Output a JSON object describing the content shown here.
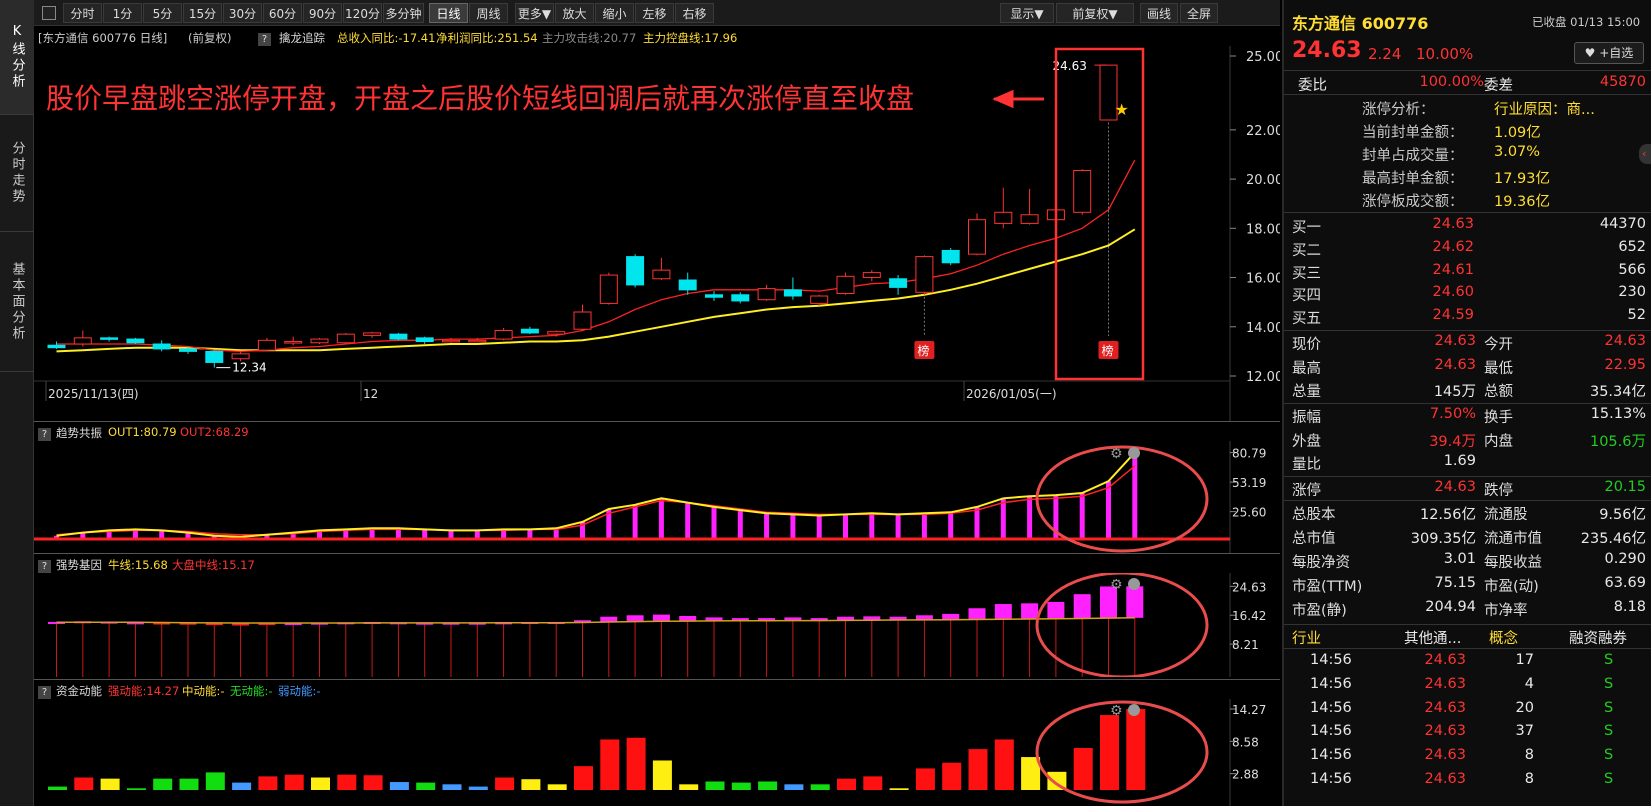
{
  "left_tabs": [
    "K线分析",
    "分时走势",
    "基本面分析"
  ],
  "toolbar": {
    "periods": [
      "分时",
      "1分",
      "5分",
      "15分",
      "30分",
      "60分",
      "90分",
      "120分",
      "多分钟",
      "日线",
      "周线",
      "更多▼",
      "放大",
      "缩小",
      "左移",
      "右移"
    ],
    "right": [
      "显示▼",
      "前复权▼",
      "画线",
      "全屏"
    ],
    "active": "日线"
  },
  "chart_header": {
    "stock": "[东方通信 600776 日线]",
    "adjust": "(前复权)",
    "indicator_name": "擒龙追踪",
    "revenue": "总收入同比:-17.41",
    "profit": "净利润同比:251.54",
    "attack": "主力攻击线:20.77",
    "control": "主力控盘线:17.96"
  },
  "annotation": "股价早盘跳空涨停开盘，开盘之后股价短线回调后就再次涨停直至收盘",
  "price_axis": [
    "25.00",
    "22.00",
    "20.00",
    "18.00",
    "16.00",
    "14.00",
    "12.00"
  ],
  "date_labels": [
    "2025/11/13(四)",
    "12",
    "2026/01/05(一)"
  ],
  "price_labels": {
    "high": "24.63",
    "low": "12.34"
  },
  "bang": "榜",
  "ind1": {
    "name": "趋势共振",
    "out1": "OUT1:80.79",
    "out2": "OUT2:68.29",
    "axis": [
      "80.79",
      "53.19",
      "25.60"
    ]
  },
  "ind2": {
    "name": "强势基因",
    "bull": "牛线:15.68",
    "mid": "大盘中线:15.17",
    "axis": [
      "24.63",
      "16.42",
      "8.21"
    ]
  },
  "ind3": {
    "name": "资金动能",
    "strong": "强动能:14.27",
    "medium": "中动能:-",
    "none": "无动能:-",
    "weak": "弱动能:-",
    "axis": [
      "14.27",
      "8.58",
      "2.88"
    ]
  },
  "colors": {
    "up": "#ff3333",
    "down": "#00e5ee",
    "ma_short": "#ff2222",
    "ma_long": "#ffee22",
    "magenta": "#ff22ff",
    "annotation": "#ff3333"
  },
  "chart_data": {
    "type": "candlestick",
    "ylim": [
      12,
      25
    ],
    "candles": [
      {
        "o": 13.25,
        "h": 13.4,
        "l": 13.1,
        "c": 13.15
      },
      {
        "o": 13.3,
        "h": 13.85,
        "l": 13.2,
        "c": 13.55
      },
      {
        "o": 13.55,
        "h": 13.6,
        "l": 13.4,
        "c": 13.5
      },
      {
        "o": 13.5,
        "h": 13.55,
        "l": 13.3,
        "c": 13.35
      },
      {
        "o": 13.3,
        "h": 13.45,
        "l": 13.0,
        "c": 13.1
      },
      {
        "o": 13.1,
        "h": 13.2,
        "l": 12.9,
        "c": 13.0
      },
      {
        "o": 13.0,
        "h": 13.05,
        "l": 12.34,
        "c": 12.55
      },
      {
        "o": 12.7,
        "h": 13.0,
        "l": 12.6,
        "c": 12.9
      },
      {
        "o": 13.05,
        "h": 13.55,
        "l": 13.0,
        "c": 13.45
      },
      {
        "o": 13.35,
        "h": 13.6,
        "l": 13.25,
        "c": 13.4
      },
      {
        "o": 13.35,
        "h": 13.55,
        "l": 13.3,
        "c": 13.5
      },
      {
        "o": 13.35,
        "h": 13.75,
        "l": 13.3,
        "c": 13.7
      },
      {
        "o": 13.65,
        "h": 13.8,
        "l": 13.55,
        "c": 13.75
      },
      {
        "o": 13.7,
        "h": 13.75,
        "l": 13.45,
        "c": 13.5
      },
      {
        "o": 13.55,
        "h": 13.6,
        "l": 13.3,
        "c": 13.4
      },
      {
        "o": 13.45,
        "h": 13.55,
        "l": 13.35,
        "c": 13.45
      },
      {
        "o": 13.45,
        "h": 13.55,
        "l": 13.4,
        "c": 13.45
      },
      {
        "o": 13.5,
        "h": 13.95,
        "l": 13.45,
        "c": 13.85
      },
      {
        "o": 13.9,
        "h": 14.0,
        "l": 13.7,
        "c": 13.75
      },
      {
        "o": 13.7,
        "h": 13.85,
        "l": 13.6,
        "c": 13.8
      },
      {
        "o": 13.9,
        "h": 14.9,
        "l": 13.85,
        "c": 14.6
      },
      {
        "o": 14.95,
        "h": 16.2,
        "l": 14.9,
        "c": 16.1
      },
      {
        "o": 16.85,
        "h": 16.95,
        "l": 15.6,
        "c": 15.7
      },
      {
        "o": 15.95,
        "h": 16.8,
        "l": 15.9,
        "c": 16.3
      },
      {
        "o": 15.9,
        "h": 16.2,
        "l": 15.3,
        "c": 15.5
      },
      {
        "o": 15.3,
        "h": 15.45,
        "l": 15.05,
        "c": 15.2
      },
      {
        "o": 15.3,
        "h": 15.4,
        "l": 14.95,
        "c": 15.05
      },
      {
        "o": 15.1,
        "h": 15.7,
        "l": 15.05,
        "c": 15.55
      },
      {
        "o": 15.5,
        "h": 16.0,
        "l": 15.1,
        "c": 15.25
      },
      {
        "o": 14.95,
        "h": 15.3,
        "l": 14.85,
        "c": 15.25
      },
      {
        "o": 15.35,
        "h": 16.2,
        "l": 15.3,
        "c": 16.05
      },
      {
        "o": 16.0,
        "h": 16.3,
        "l": 15.85,
        "c": 16.2
      },
      {
        "o": 15.95,
        "h": 16.1,
        "l": 15.3,
        "c": 15.6
      },
      {
        "o": 15.4,
        "h": 16.9,
        "l": 15.3,
        "c": 16.85
      },
      {
        "o": 17.1,
        "h": 17.2,
        "l": 16.5,
        "c": 16.6
      },
      {
        "o": 16.95,
        "h": 18.6,
        "l": 16.9,
        "c": 18.35
      },
      {
        "o": 18.2,
        "h": 19.65,
        "l": 18.0,
        "c": 18.65
      },
      {
        "o": 18.2,
        "h": 19.6,
        "l": 18.15,
        "c": 18.55
      },
      {
        "o": 18.35,
        "h": 18.9,
        "l": 18.0,
        "c": 18.75
      },
      {
        "o": 18.65,
        "h": 20.4,
        "l": 18.55,
        "c": 20.35
      },
      {
        "o": 22.4,
        "h": 24.63,
        "l": 22.38,
        "c": 24.63
      }
    ],
    "ma_short": [
      13.3,
      13.3,
      13.3,
      13.3,
      13.25,
      13.2,
      13.05,
      13.0,
      13.05,
      13.15,
      13.2,
      13.3,
      13.4,
      13.45,
      13.45,
      13.5,
      13.5,
      13.55,
      13.6,
      13.65,
      13.85,
      14.2,
      14.7,
      15.1,
      15.35,
      15.5,
      15.5,
      15.5,
      15.5,
      15.45,
      15.6,
      15.75,
      15.8,
      15.95,
      16.15,
      16.5,
      16.95,
      17.3,
      17.6,
      18.0,
      18.75,
      20.77
    ],
    "ma_long": [
      13.0,
      13.05,
      13.1,
      13.15,
      13.15,
      13.15,
      13.1,
      13.05,
      13.05,
      13.05,
      13.05,
      13.1,
      13.15,
      13.2,
      13.25,
      13.3,
      13.3,
      13.35,
      13.4,
      13.4,
      13.45,
      13.6,
      13.8,
      14.0,
      14.2,
      14.4,
      14.55,
      14.7,
      14.8,
      14.85,
      14.95,
      15.05,
      15.15,
      15.3,
      15.5,
      15.75,
      16.05,
      16.35,
      16.65,
      16.95,
      17.3,
      17.96
    ],
    "osc_out1": [
      3,
      6,
      8,
      9,
      8,
      6,
      3,
      2,
      4,
      6,
      8,
      9,
      10,
      10,
      9,
      8,
      8,
      9,
      9,
      10,
      16,
      28,
      32,
      38,
      34,
      30,
      27,
      24,
      23,
      22,
      23,
      24,
      23,
      24,
      25,
      30,
      38,
      40,
      41,
      43,
      54,
      80.79
    ],
    "osc_out2": [
      4,
      6,
      7,
      8,
      8,
      7,
      5,
      4,
      4,
      5,
      7,
      8,
      9,
      9,
      9,
      8,
      8,
      8,
      9,
      9,
      13,
      24,
      30,
      36,
      34,
      31,
      28,
      25,
      24,
      23,
      23,
      23,
      23,
      23,
      24,
      27,
      34,
      37,
      38,
      40,
      48,
      68.29
    ],
    "gene_values": [
      14.5,
      14.7,
      14.6,
      14.4,
      14.2,
      14.0,
      13.6,
      13.5,
      13.9,
      14.2,
      14.3,
      14.4,
      14.5,
      14.4,
      14.3,
      14.3,
      14.3,
      14.4,
      14.5,
      14.5,
      15.0,
      16.0,
      16.4,
      16.6,
      16.2,
      15.8,
      15.6,
      15.6,
      15.8,
      15.6,
      16.0,
      16.1,
      16.0,
      16.4,
      16.8,
      18.4,
      19.6,
      19.8,
      20.2,
      22.4,
      24.6,
      24.63
    ],
    "bull_line": [
      14.4,
      14.4,
      14.4,
      14.4,
      14.35,
      14.3,
      14.25,
      14.2,
      14.2,
      14.2,
      14.2,
      14.2,
      14.25,
      14.25,
      14.25,
      14.25,
      14.25,
      14.3,
      14.3,
      14.3,
      14.35,
      14.5,
      14.6,
      14.7,
      14.75,
      14.8,
      14.85,
      14.85,
      14.9,
      14.9,
      14.95,
      15.0,
      15.05,
      15.1,
      15.15,
      15.2,
      15.3,
      15.35,
      15.4,
      15.5,
      15.6,
      15.68
    ],
    "energy": [
      {
        "v": 0.6,
        "c": "g"
      },
      {
        "v": 2.2,
        "c": "r"
      },
      {
        "v": 2.0,
        "c": "y"
      },
      {
        "v": 0.3,
        "c": "g"
      },
      {
        "v": 2.0,
        "c": "g"
      },
      {
        "v": 2.0,
        "c": "g"
      },
      {
        "v": 3.1,
        "c": "g"
      },
      {
        "v": 1.3,
        "c": "b"
      },
      {
        "v": 2.4,
        "c": "r"
      },
      {
        "v": 2.7,
        "c": "r"
      },
      {
        "v": 2.2,
        "c": "y"
      },
      {
        "v": 2.7,
        "c": "r"
      },
      {
        "v": 2.6,
        "c": "r"
      },
      {
        "v": 1.4,
        "c": "b"
      },
      {
        "v": 1.3,
        "c": "g"
      },
      {
        "v": 1.0,
        "c": "b"
      },
      {
        "v": 0.6,
        "c": "b"
      },
      {
        "v": 2.2,
        "c": "r"
      },
      {
        "v": 1.9,
        "c": "y"
      },
      {
        "v": 1.0,
        "c": "y"
      },
      {
        "v": 4.2,
        "c": "r"
      },
      {
        "v": 8.9,
        "c": "r"
      },
      {
        "v": 9.2,
        "c": "r"
      },
      {
        "v": 5.2,
        "c": "y"
      },
      {
        "v": 1.0,
        "c": "y"
      },
      {
        "v": 1.5,
        "c": "g"
      },
      {
        "v": 1.3,
        "c": "g"
      },
      {
        "v": 1.5,
        "c": "g"
      },
      {
        "v": 1.0,
        "c": "b"
      },
      {
        "v": 1.0,
        "c": "g"
      },
      {
        "v": 2.0,
        "c": "r"
      },
      {
        "v": 2.4,
        "c": "r"
      },
      {
        "v": 0.3,
        "c": "y"
      },
      {
        "v": 3.8,
        "c": "r"
      },
      {
        "v": 4.8,
        "c": "r"
      },
      {
        "v": 7.2,
        "c": "r"
      },
      {
        "v": 8.9,
        "c": "r"
      },
      {
        "v": 5.8,
        "c": "y"
      },
      {
        "v": 3.2,
        "c": "y"
      },
      {
        "v": 7.4,
        "c": "r"
      },
      {
        "v": 13.2,
        "c": "r"
      },
      {
        "v": 14.27,
        "c": "r"
      }
    ]
  },
  "right_panel": {
    "title": "东方通信 600776",
    "status": "已收盘 01/13 15:00",
    "price": "24.63",
    "change": "2.24",
    "pct": "10.00%",
    "watch_btn": "♥ +自选",
    "wb_label": "委比",
    "wb": "100.00%",
    "wc_label": "委差",
    "wc": "45870",
    "limit_analysis": [
      {
        "k": "涨停分析：",
        "v": "行业原因：商..."
      },
      {
        "k": "当前封单金额：",
        "v": "1.09亿"
      },
      {
        "k": "封单占成交量：",
        "v": "3.07%"
      },
      {
        "k": "最高封单金额：",
        "v": "17.93亿"
      },
      {
        "k": "涨停板成交额：",
        "v": "19.36亿"
      }
    ],
    "bids": [
      {
        "k": "买一",
        "p": "24.63",
        "v": "44370"
      },
      {
        "k": "买二",
        "p": "24.62",
        "v": "652"
      },
      {
        "k": "买三",
        "p": "24.61",
        "v": "566"
      },
      {
        "k": "买四",
        "p": "24.60",
        "v": "230"
      },
      {
        "k": "买五",
        "p": "24.59",
        "v": "52"
      }
    ],
    "quote": [
      {
        "k1": "现价",
        "v1": "24.63",
        "c1": "red",
        "k2": "今开",
        "v2": "24.63",
        "c2": "red"
      },
      {
        "k1": "最高",
        "v1": "24.63",
        "c1": "red",
        "k2": "最低",
        "v2": "22.95",
        "c2": "red"
      },
      {
        "k1": "总量",
        "v1": "145万",
        "c1": "white",
        "k2": "总额",
        "v2": "35.34亿",
        "c2": "white"
      }
    ],
    "quote2": [
      {
        "k1": "振幅",
        "v1": "7.50%",
        "c1": "red",
        "k2": "换手",
        "v2": "15.13%",
        "c2": "white"
      },
      {
        "k1": "外盘",
        "v1": "39.4万",
        "c1": "red",
        "k2": "内盘",
        "v2": "105.6万",
        "c2": "green"
      },
      {
        "k1": "量比",
        "v1": "1.69",
        "c1": "white",
        "k2": "",
        "v2": "",
        "c2": "white"
      }
    ],
    "quote3": [
      {
        "k1": "涨停",
        "v1": "24.63",
        "c1": "red",
        "k2": "跌停",
        "v2": "20.15",
        "c2": "green"
      }
    ],
    "fund": [
      {
        "k1": "总股本",
        "v1": "12.56亿",
        "k2": "流通股",
        "v2": "9.56亿"
      },
      {
        "k1": "总市值",
        "v1": "309.35亿",
        "k2": "流通市值",
        "v2": "235.46亿"
      },
      {
        "k1": "每股净资",
        "v1": "3.01",
        "k2": "每股收益",
        "v2": "0.290"
      },
      {
        "k1": "市盈(TTM)",
        "v1": "75.15",
        "k2": "市盈(动)",
        "v2": "63.69"
      },
      {
        "k1": "市盈(静)",
        "v1": "204.94",
        "k2": "市净率",
        "v2": "8.18"
      }
    ],
    "tabs": [
      "行业",
      "其他通...",
      "概念",
      "融资融券"
    ],
    "ticks": [
      {
        "t": "14:56",
        "p": "24.63",
        "v": "17",
        "s": "S"
      },
      {
        "t": "14:56",
        "p": "24.63",
        "v": "4",
        "s": "S"
      },
      {
        "t": "14:56",
        "p": "24.63",
        "v": "20",
        "s": "S"
      },
      {
        "t": "14:56",
        "p": "24.63",
        "v": "37",
        "s": "S"
      },
      {
        "t": "14:56",
        "p": "24.63",
        "v": "8",
        "s": "S"
      },
      {
        "t": "14:56",
        "p": "24.63",
        "v": "8",
        "s": "S"
      }
    ]
  }
}
